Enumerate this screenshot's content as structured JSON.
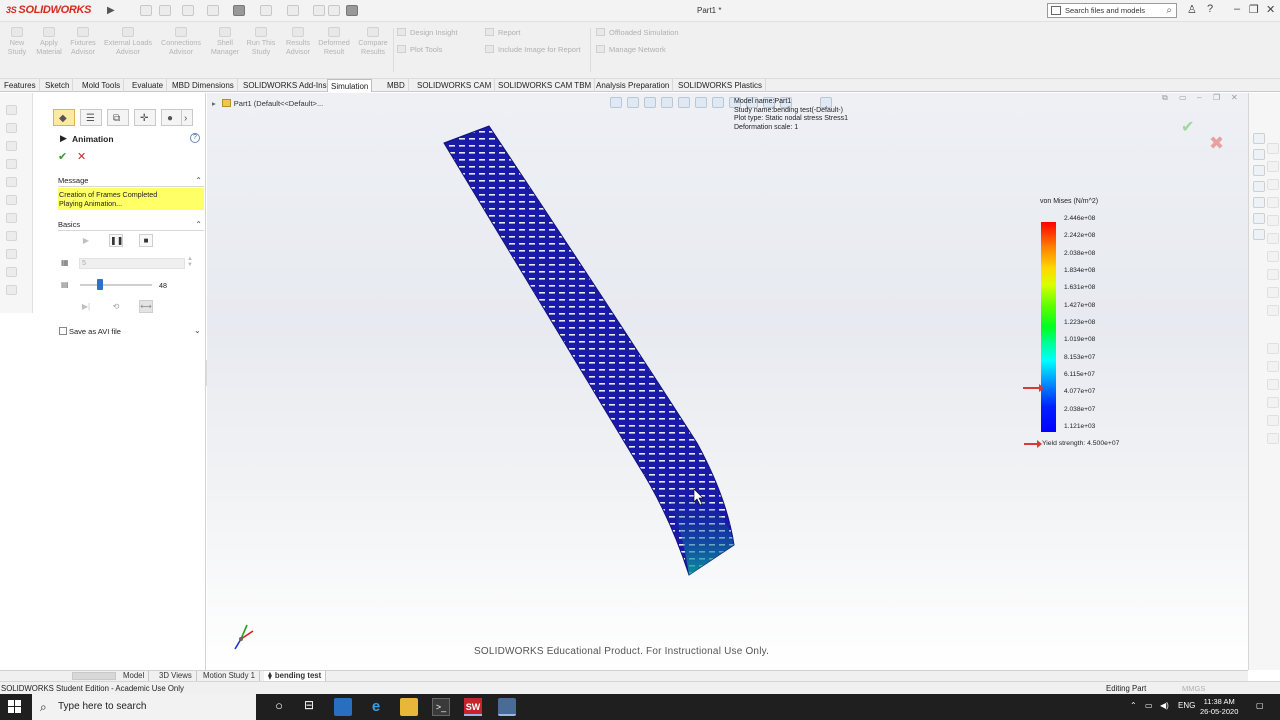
{
  "app": {
    "brand": "SOLIDWORKS",
    "doc_title": "Part1 *",
    "search_placeholder": "Search files and models"
  },
  "command_manager": {
    "buttons": [
      {
        "label": "New\nStudy"
      },
      {
        "label": "Apply\nMaterial"
      },
      {
        "label": "Fixtures\nAdvisor"
      },
      {
        "label": "External Loads\nAdvisor"
      },
      {
        "label": "Connections\nAdvisor"
      },
      {
        "label": "Shell\nManager"
      },
      {
        "label": "Run This\nStudy"
      },
      {
        "label": "Results\nAdvisor"
      },
      {
        "label": "Deformed\nResult"
      },
      {
        "label": "Compare\nResults"
      }
    ],
    "design_insight": "Design Insight",
    "plot_tools": "Plot Tools",
    "report": "Report",
    "include_image": "Include Image for Report",
    "offloaded_sim": "Offloaded Simulation",
    "manage_network": "Manage Network"
  },
  "tabs": [
    {
      "label": "Features"
    },
    {
      "label": "Sketch"
    },
    {
      "label": "Mold Tools"
    },
    {
      "label": "Evaluate"
    },
    {
      "label": "MBD Dimensions"
    },
    {
      "label": "SOLIDWORKS Add-Ins"
    },
    {
      "label": "Simulation"
    },
    {
      "label": "MBD"
    },
    {
      "label": "SOLIDWORKS CAM"
    },
    {
      "label": "SOLIDWORKS CAM TBM"
    },
    {
      "label": "Analysis Preparation"
    },
    {
      "label": "SOLIDWORKS Plastics"
    }
  ],
  "property_manager": {
    "title": "Animation",
    "message_header": "Message",
    "message_line1": "Creation of Frames Completed",
    "message_line2": "Playing Animation...",
    "basics_header": "Basics",
    "frames_value": "5",
    "speed_value": "48",
    "speed_fraction": 0.28,
    "save_avi_label": "Save as AVI file"
  },
  "viewport": {
    "tree_label": "Part1  (Default<<Default>...",
    "model_name": "Model name:Part1",
    "study_name": "Study name:bending test(-Default-)",
    "plot_type": "Plot type: Static nodal stress Stress1",
    "deformation_scale": "Deformation scale: 1",
    "legend_title": "von Mises (N/m^2)",
    "legend_ticks": [
      "2.446e+08",
      "2.242e+08",
      "2.038e+08",
      "1.834e+08",
      "1.631e+08",
      "1.427e+08",
      "1.223e+08",
      "1.019e+08",
      "8.153e+07",
      "6.115e+07",
      "4.077e+07",
      "2.038e+07",
      "1.121e+03"
    ],
    "yield_strength": "Yield strength: 4.500e+07",
    "watermark": "SOLIDWORKS Educational Product. For Instructional Use Only."
  },
  "bottom_tabs": [
    {
      "label": "Model"
    },
    {
      "label": "3D Views"
    },
    {
      "label": "Motion Study 1"
    },
    {
      "label": "bending test"
    }
  ],
  "status": {
    "left": "SOLIDWORKS Student Edition - Academic Use Only",
    "editing": "Editing Part",
    "units": "MMGS"
  },
  "taskbar": {
    "search_placeholder": "Type here to search",
    "language": "ENG",
    "time": "11:38 AM",
    "date": "26-05-2020"
  }
}
